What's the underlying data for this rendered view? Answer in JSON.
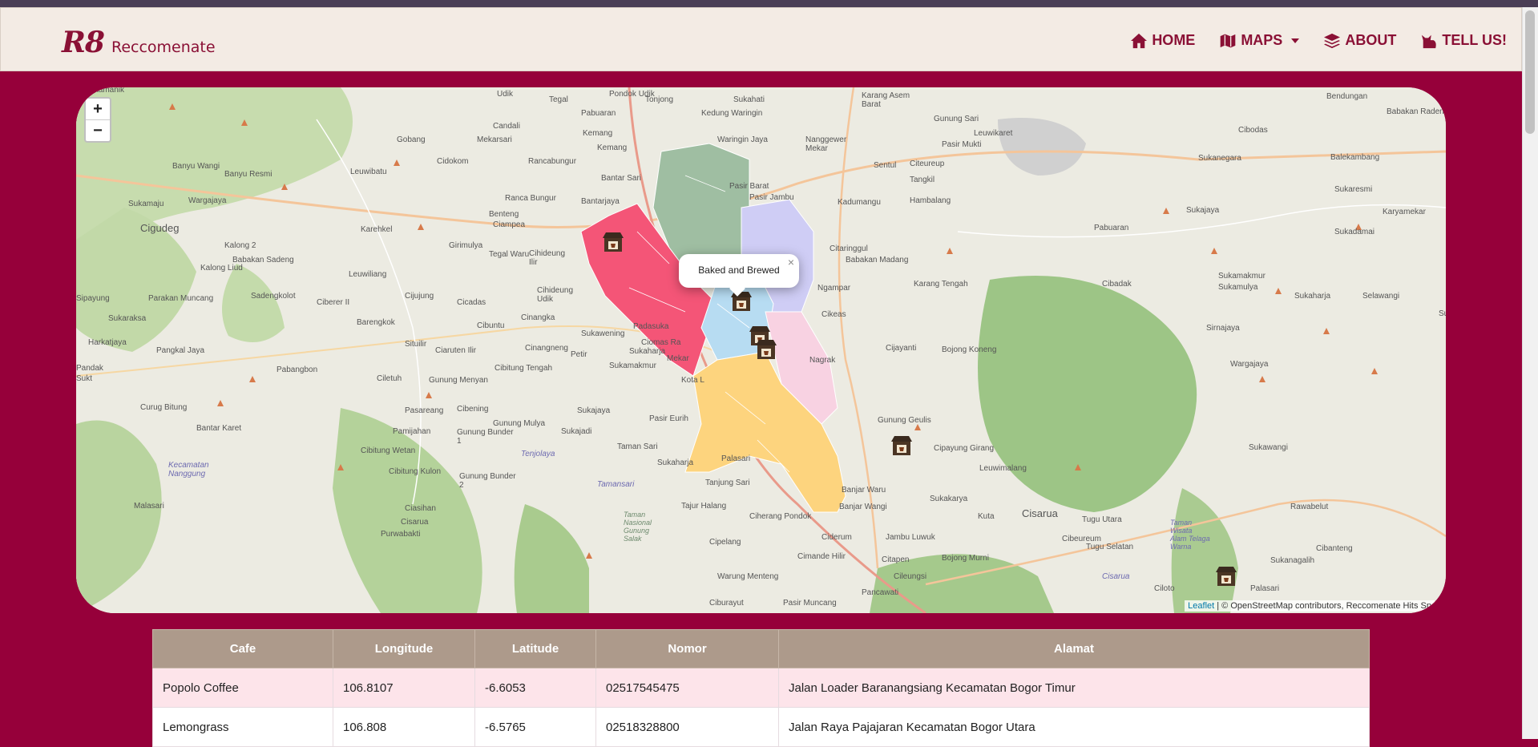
{
  "navbar": {
    "brand_mark": "R8",
    "brand_name": "Reccomenate",
    "items": [
      {
        "label": "HOME",
        "icon": "home-icon"
      },
      {
        "label": "MAPS",
        "icon": "map-icon"
      },
      {
        "label": "ABOUT",
        "icon": "layers-icon"
      },
      {
        "label": "TELL US!",
        "icon": "cat-icon"
      }
    ]
  },
  "map": {
    "zoom_in": "+",
    "zoom_out": "−",
    "popup_text": "Baked and Brewed",
    "popup_close": "×",
    "attribution_leaflet": "Leaflet",
    "attribution_rest": " | © OpenStreetMap contributors, Reccomenate Hits Sp",
    "region_colors": {
      "north": "#9fbea2",
      "west": "#f45577",
      "center": "#b7dcf2",
      "east": "#cfcdf5",
      "south": "#fdd47e",
      "southeast": "#f8d2e2"
    },
    "labels": [
      "Cintamanik",
      "Udik",
      "Tegal",
      "Pondok Udik",
      "Tonjong",
      "Sukahati",
      "Karang Asem Barat",
      "Bendungan",
      "Pabuaran",
      "Kedung Waringin",
      "Cibodas",
      "Babakan Raden",
      "Gobang",
      "Cidokom",
      "Mekarsari",
      "Kemang",
      "Waringin Jaya",
      "Nanggewer Mekar",
      "Gunung Sari",
      "Leuwikaret",
      "Banyu Wangi",
      "Banyu Resmi",
      "Leuwibatu",
      "Rancabungur",
      "Bantar Sari",
      "Bantar Jaya",
      "Pasir Mukti",
      "Citeureup",
      "Sentul",
      "Tangkil",
      "Sukanegara",
      "Balekambang",
      "Sukamaju",
      "Wargajaya",
      "Ranca Bungur",
      "Pasir Jambu",
      "Kadumangu",
      "Hambalang",
      "Sukajaya",
      "Sukaresmi",
      "Karyamekar",
      "Cigudeg",
      "Benteng",
      "Ciampea",
      "Karehkel",
      "Pabuaran",
      "Sukadamai",
      "Kalong 2",
      "Cibanteng",
      "Citaringgul",
      "Kalong Liud",
      "Babakan Sadeng",
      "Leuwiliang",
      "Girimulya",
      "Tegal Waru",
      "Cihideung Ilir",
      "Babakan Madang",
      "Karang Tengah",
      "Sukamakmur",
      "Cibadak",
      "Sukamulya",
      "Sukaharja",
      "Selawangi",
      "Sipayung",
      "Parakan Muncang",
      "Sadengkolot",
      "Ciberer II",
      "Cijujung",
      "Cicadas",
      "Cihideung Udik",
      "Ngampar",
      "Sukaraksa",
      "Barengkok",
      "Cibuntu",
      "Cinangka",
      "Padasuka",
      "Cikeas",
      "Sirnajaya",
      "Harkatjaya",
      "Pangkal Jaya",
      "Situilir",
      "Ciaruten Ilir",
      "Cinangneng",
      "Sukawening",
      "Ciomas Rahayu",
      "Cijayanti",
      "Bojong Koneng",
      "Wargajaya",
      "Pandak",
      "Pabangbon",
      "Ciletuh",
      "Gunung Menyan",
      "Cibitung Tengah",
      "Petir",
      "Sukamakmur",
      "Mekar",
      "Kota Batu",
      "Nagrak",
      "Curug Bitung",
      "Pasareang",
      "Cibening",
      "Sukajaya",
      "Pasir Eurih",
      "Gunung Geulis",
      "Sukawangi",
      "Bantar Karet",
      "Pamijahan",
      "Gunung Mulya",
      "Sukajadi",
      "Taman Sari",
      "Cipayung Girang",
      "Cibitung Wetan",
      "Gunung Bunder 1",
      "Tenjolaya",
      "Sukaharja",
      "Palasari",
      "Leuwimalang",
      "Kecamatan Nanggung",
      "Cibitung Kulon",
      "Gunung Bunder 2",
      "Tamansari",
      "Tanjung Sari",
      "Banjar Waru",
      "Sukakarya",
      "Kuta",
      "Cisarua",
      "Tugu Utara",
      "Rawabelut",
      "Malasari",
      "Ciasihan",
      "Tajur Halang",
      "Ciherang Pondok",
      "Banjar Wangi",
      "Cibeureum",
      "Tugu Selatan",
      "Taman Nasional Gunung Salak",
      "Cisarua",
      "Cipelang",
      "Ciderum",
      "Jambu Luwuk",
      "Taman Wisata Alam Telaga Warna",
      "Cibanteng",
      "Purwabakti",
      "Citapen",
      "Bojong Murni",
      "Sukanagalih",
      "Warung Menteng",
      "Cimande Hilir",
      "Cileungsi",
      "Ciburayut",
      "Pasir Muncang",
      "Pancawati",
      "Ciloto",
      "Palasari"
    ]
  },
  "table": {
    "headers": [
      "Cafe",
      "Longitude",
      "Latitude",
      "Nomor",
      "Alamat"
    ],
    "rows": [
      {
        "cafe": "Popolo Coffee",
        "longitude": "106.8107",
        "latitude": "-6.6053",
        "nomor": "02517545475",
        "alamat": "Jalan Loader Baranangsiang Kecamatan Bogor Timur"
      },
      {
        "cafe": "Lemongrass",
        "longitude": "106.808",
        "latitude": "-6.5765",
        "nomor": "02518328800",
        "alamat": "Jalan Raya Pajajaran Kecamatan Bogor Utara"
      }
    ]
  }
}
